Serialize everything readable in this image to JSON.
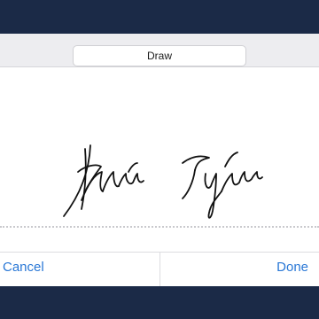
{
  "segment": {
    "selected_label": "Draw"
  },
  "signature": {
    "ink_color": "#111111"
  },
  "actions": {
    "cancel_label": "Cancel",
    "done_label": "Done",
    "accent_color": "#2a78d6"
  }
}
